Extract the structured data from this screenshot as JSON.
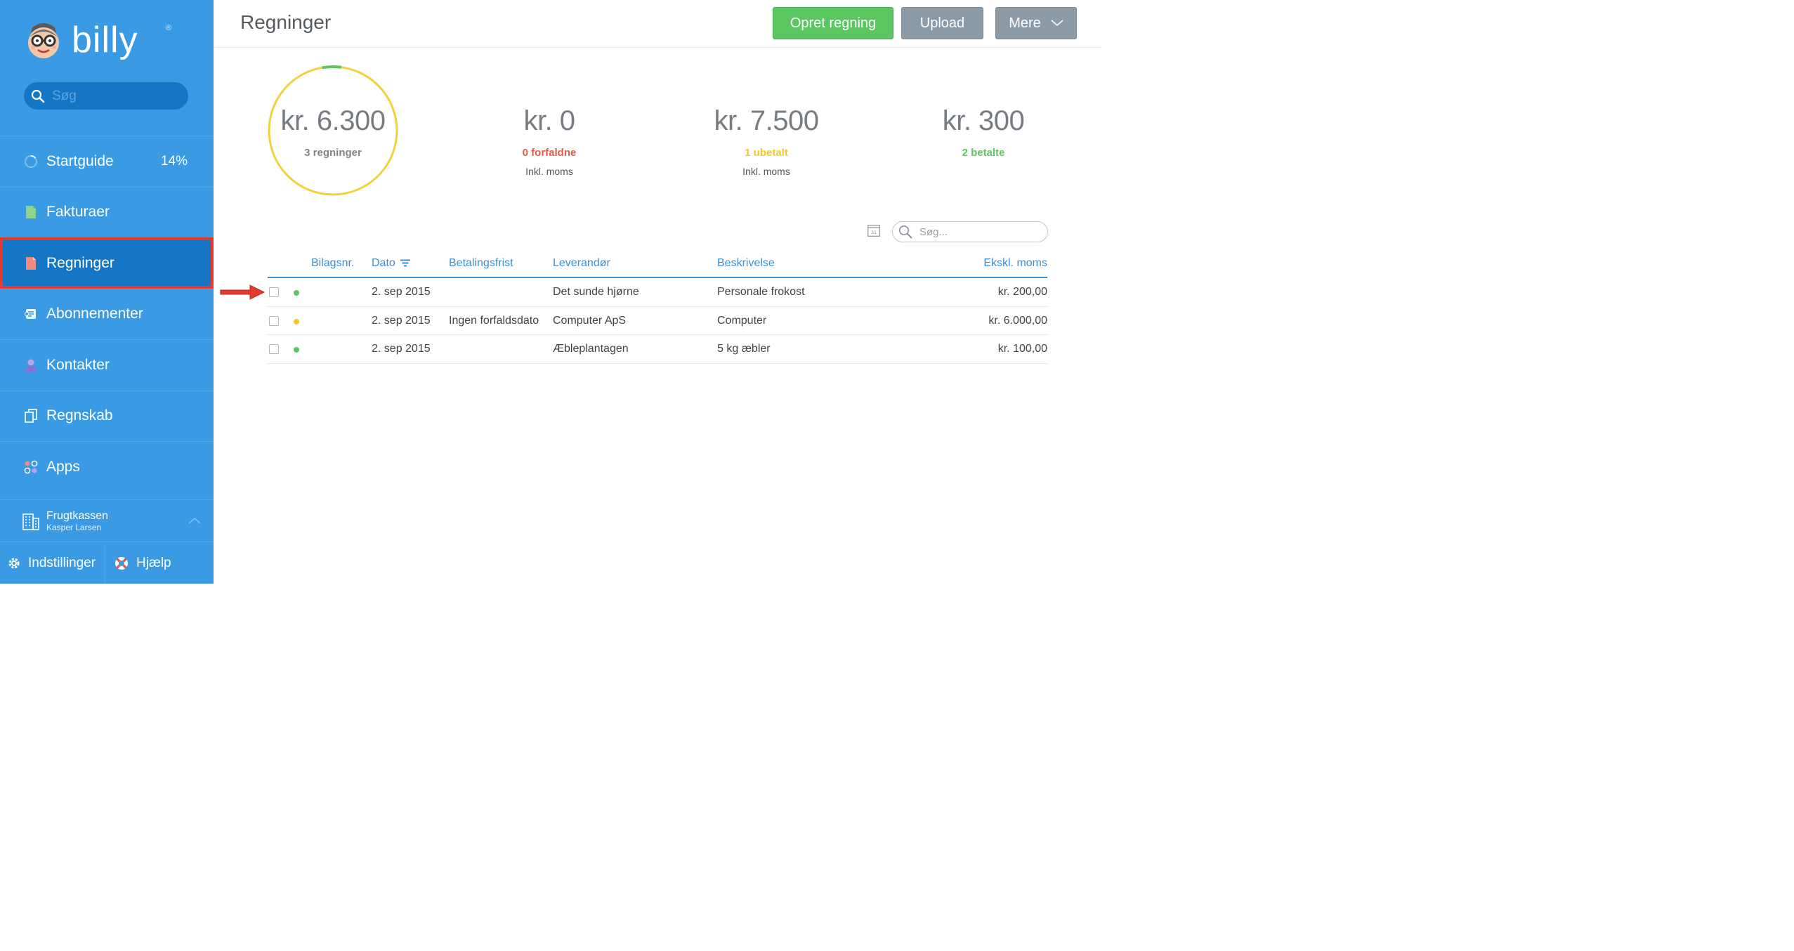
{
  "sidebar": {
    "logo_text": "billy",
    "logo_reg": "®",
    "search_placeholder": "Søg",
    "items": [
      {
        "label": "Startguide",
        "icon": "progress-ring-icon",
        "badge": "14%"
      },
      {
        "label": "Fakturaer",
        "icon": "invoice-icon"
      },
      {
        "label": "Regninger",
        "icon": "bill-icon",
        "active": true
      },
      {
        "label": "Abonnementer",
        "icon": "subscription-icon"
      },
      {
        "label": "Kontakter",
        "icon": "person-icon"
      },
      {
        "label": "Regnskab",
        "icon": "ledger-icon"
      },
      {
        "label": "Apps",
        "icon": "apps-icon"
      }
    ],
    "org": {
      "name": "Frugtkassen",
      "user": "Kasper Larsen"
    },
    "bottom": {
      "settings": "Indstillinger",
      "help": "Hjælp"
    }
  },
  "header": {
    "title": "Regninger",
    "create_button": "Opret regning",
    "upload_button": "Upload",
    "more_button": "Mere"
  },
  "summary": [
    {
      "amount": "kr. 6.300",
      "label": "3 regninger",
      "note": ""
    },
    {
      "amount": "kr. 0",
      "label": "0 forfaldne",
      "note": "Inkl. moms"
    },
    {
      "amount": "kr. 7.500",
      "label": "1 ubetalt",
      "note": "Inkl. moms"
    },
    {
      "amount": "kr. 300",
      "label": "2 betalte",
      "note": ""
    }
  ],
  "table_tools": {
    "search_placeholder": "Søg...",
    "calendar_day": "31"
  },
  "table": {
    "headers": {
      "bilagsnr": "Bilagsnr.",
      "dato": "Dato",
      "betalingsfrist": "Betalingsfrist",
      "leverandor": "Leverandør",
      "beskrivelse": "Beskrivelse",
      "amount": "Ekskl. moms"
    },
    "rows": [
      {
        "status": "paid",
        "bilagsnr": "",
        "dato": "2. sep 2015",
        "frist": "",
        "leverandor": "Det sunde hjørne",
        "beskrivelse": "Personale frokost",
        "amount": "kr. 200,00"
      },
      {
        "status": "unpaid",
        "bilagsnr": "",
        "dato": "2. sep 2015",
        "frist": "Ingen forfaldsdato",
        "leverandor": "Computer ApS",
        "beskrivelse": "Computer",
        "amount": "kr. 6.000,00"
      },
      {
        "status": "paid",
        "bilagsnr": "",
        "dato": "2. sep 2015",
        "frist": "",
        "leverandor": "Æbleplantagen",
        "beskrivelse": "5 kg æbler",
        "amount": "kr. 100,00"
      }
    ]
  },
  "colors": {
    "sidebar": "#3a9ae4",
    "sidebar_active": "#1676c6",
    "highlight": "#e53a2f",
    "accent": "#3a8fd6",
    "green": "#5bc760",
    "yellow": "#f2c928",
    "red": "#e4594a",
    "grey_button": "#8c9ba6"
  },
  "ring": {
    "paid_fraction": 0.048
  }
}
